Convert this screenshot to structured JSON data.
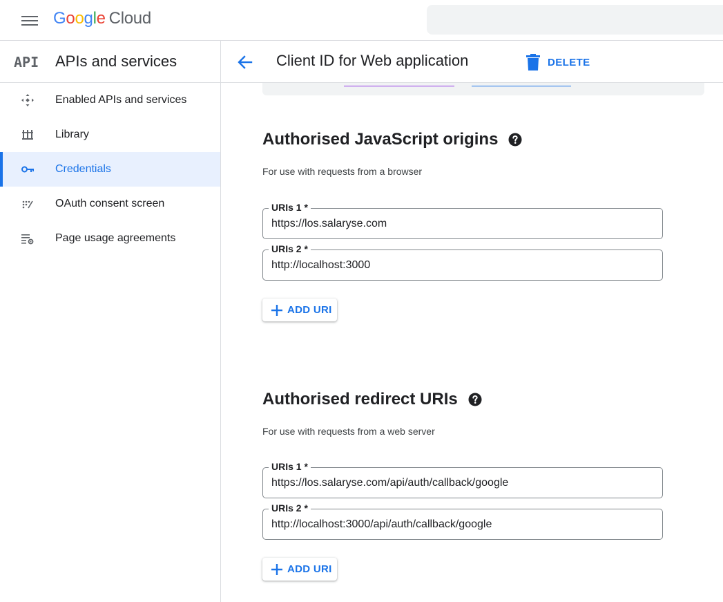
{
  "topbar": {
    "logo": {
      "g1": "G",
      "o1": "o",
      "o2": "o",
      "g2": "g",
      "l": "l",
      "e": "e",
      "product": "Cloud"
    }
  },
  "sidebar": {
    "badge": "API",
    "title": "APIs and services",
    "items": [
      {
        "label": "Enabled APIs and services",
        "icon": "enabled-apis-icon",
        "active": false
      },
      {
        "label": "Library",
        "icon": "library-icon",
        "active": false
      },
      {
        "label": "Credentials",
        "icon": "key-icon",
        "active": true
      },
      {
        "label": "OAuth consent screen",
        "icon": "oauth-consent-icon",
        "active": false
      },
      {
        "label": "Page usage agreements",
        "icon": "settings-list-icon",
        "active": false
      }
    ]
  },
  "header": {
    "title": "Client ID for Web application",
    "delete_label": "DELETE"
  },
  "js_origins": {
    "title": "Authorised JavaScript origins",
    "description": "For use with requests from a browser",
    "fields": [
      {
        "label": "URIs 1 *",
        "value": "https://los.salaryse.com"
      },
      {
        "label": "URIs 2 *",
        "value": "http://localhost:3000"
      }
    ],
    "add_label": "ADD URI"
  },
  "redirect_uris": {
    "title": "Authorised redirect URIs",
    "description": "For use with requests from a web server",
    "fields": [
      {
        "label": "URIs 1 *",
        "value": "https://los.salaryse.com/api/auth/callback/google"
      },
      {
        "label": "URIs 2 *",
        "value": "http://localhost:3000/api/auth/callback/google"
      }
    ],
    "add_label": "ADD URI"
  },
  "colors": {
    "accent": "#1a73e8",
    "active_bg": "#e8f0fe",
    "border": "#dadce0",
    "icon_grey": "#5f6368"
  }
}
